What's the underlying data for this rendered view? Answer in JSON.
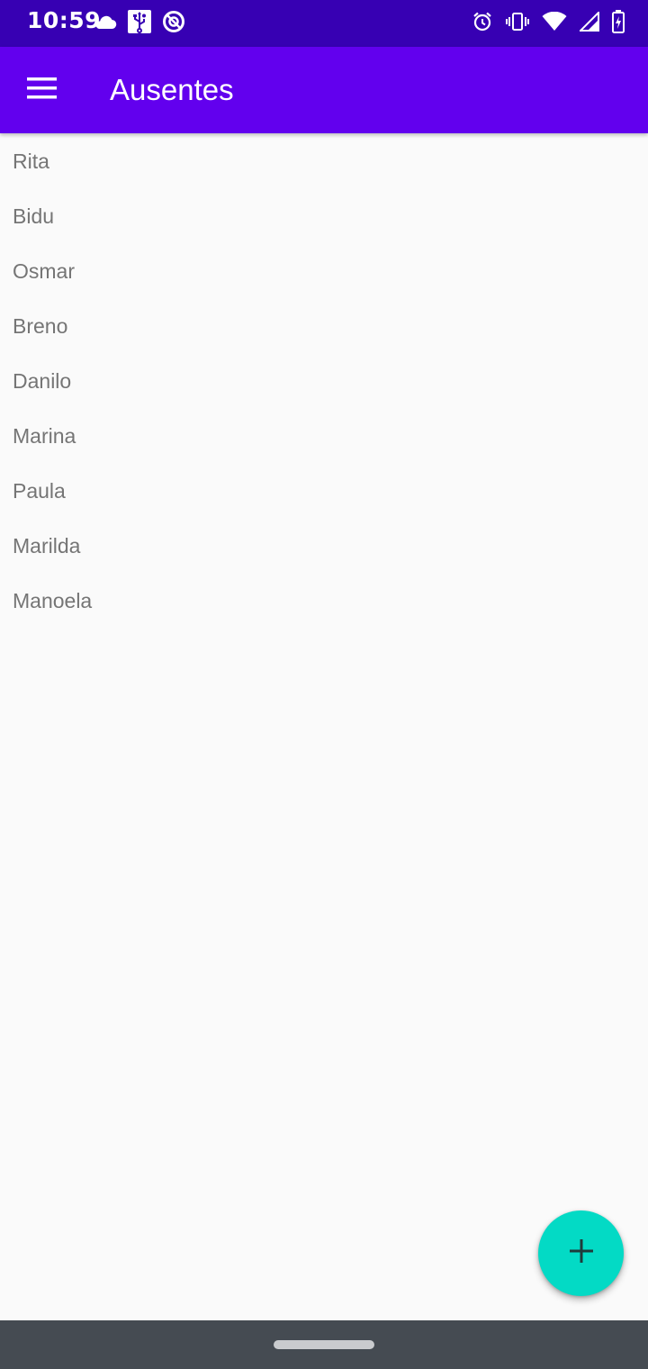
{
  "status_bar": {
    "time": "10:59",
    "left_icons": [
      "cloud-icon",
      "usb-icon",
      "do-not-disturb-icon"
    ],
    "right_icons": [
      "alarm-icon",
      "vibrate-icon",
      "wifi-icon",
      "cellular-signal-icon",
      "battery-charging-icon"
    ]
  },
  "app_bar": {
    "title": "Ausentes",
    "menu_icon": "hamburger-menu-icon"
  },
  "list": {
    "items": [
      "Rita",
      "Bidu",
      "Osmar",
      "Breno",
      "Danilo",
      "Marina",
      "Paula",
      "Marilda",
      "Manoela"
    ]
  },
  "fab": {
    "icon": "plus-icon"
  },
  "colors": {
    "status_bar": "#3700b3",
    "app_bar": "#6200ee",
    "fab": "#03dac5",
    "list_text": "#757575",
    "background": "#fafafa",
    "nav_bar": "#454b52"
  }
}
